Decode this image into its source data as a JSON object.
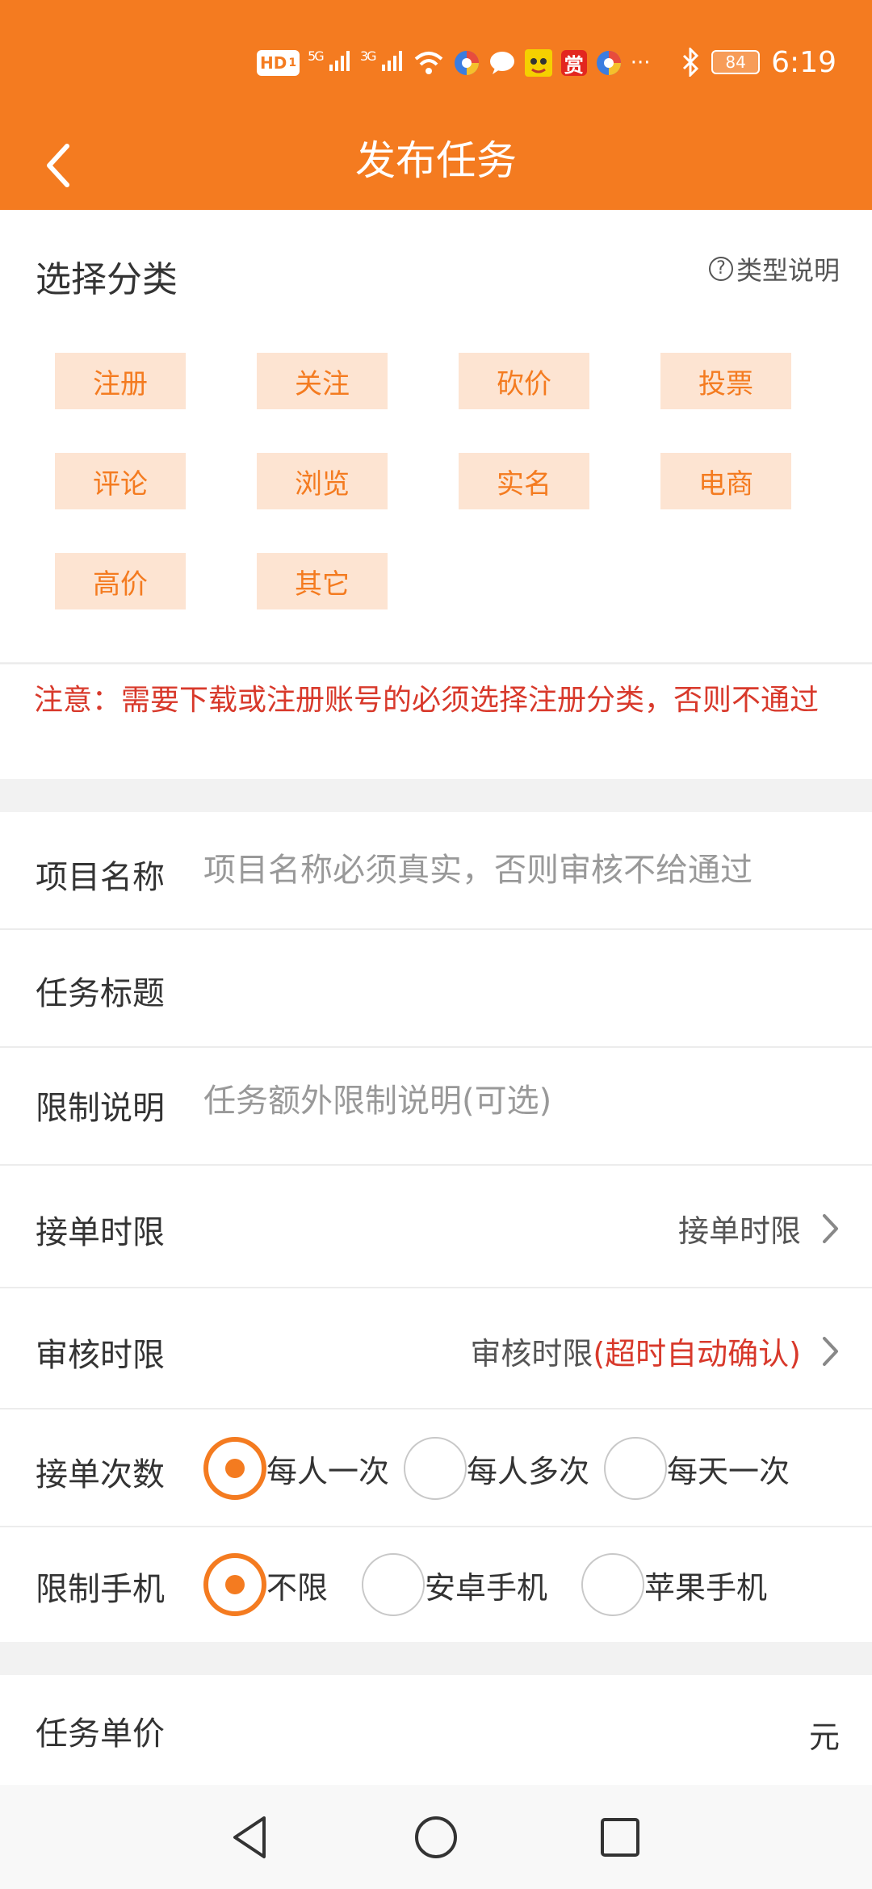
{
  "status_bar": {
    "hd_label": "HD",
    "hd_sub": "1",
    "sig1_label": "5G",
    "sig2_label": "3G",
    "reward_label": "赏",
    "more_label": "···",
    "battery": "84",
    "time": "6:19"
  },
  "header": {
    "title": "发布任务"
  },
  "category": {
    "title": "选择分类",
    "help_label": "类型说明",
    "items": [
      "注册",
      "关注",
      "砍价",
      "投票",
      "评论",
      "浏览",
      "实名",
      "电商",
      "高价",
      "其它"
    ]
  },
  "notice": {
    "text": "注意：需要下载或注册账号的必须选择注册分类，否则不通过"
  },
  "form": {
    "project_name": {
      "label": "项目名称",
      "placeholder": "项目名称必须真实，否则审核不给通过"
    },
    "task_title": {
      "label": "任务标题",
      "placeholder": ""
    },
    "limit_desc": {
      "label": "限制说明",
      "placeholder": "任务额外限制说明(可选)"
    },
    "accept_deadline": {
      "label": "接单时限",
      "value": "接单时限"
    },
    "review_deadline": {
      "label": "审核时限",
      "value": "审核时限",
      "value_note": "(超时自动确认)"
    },
    "accept_times": {
      "label": "接单次数",
      "options": [
        "每人一次",
        "每人多次",
        "每天一次"
      ],
      "selected_index": 0
    },
    "phone_limit": {
      "label": "限制手机",
      "options": [
        "不限",
        "安卓手机",
        "苹果手机"
      ],
      "selected_index": 0
    }
  },
  "price": {
    "label": "任务单价",
    "unit": "元"
  },
  "colors": {
    "accent": "#f47b20",
    "chip_bg": "#fde4d2",
    "warning": "#d8392b"
  }
}
